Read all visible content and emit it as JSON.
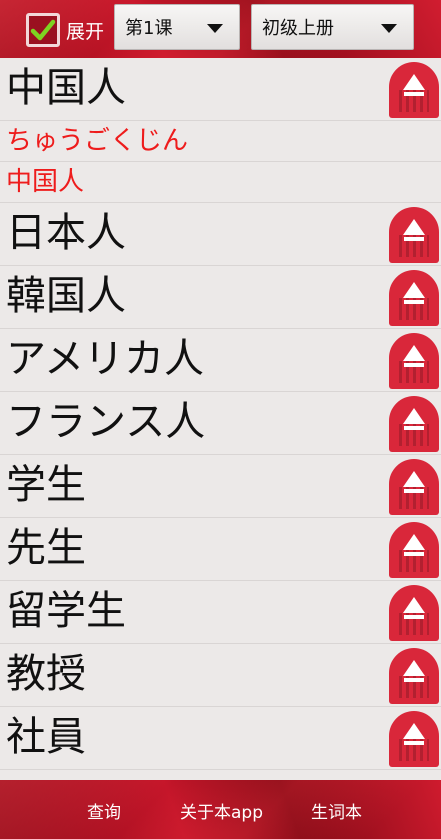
{
  "header": {
    "expand_label": "展开",
    "expand_checked": true,
    "lesson_select": "第1课",
    "book_select": "初级上册"
  },
  "words": [
    {
      "word": "中国人",
      "expanded": true,
      "reading": "ちゅうごくじん",
      "meaning": "中国人"
    },
    {
      "word": "日本人"
    },
    {
      "word": "韓国人"
    },
    {
      "word": "アメリカ人"
    },
    {
      "word": "フランス人"
    },
    {
      "word": "学生"
    },
    {
      "word": "先生"
    },
    {
      "word": "留学生"
    },
    {
      "word": "教授"
    },
    {
      "word": "社員"
    }
  ],
  "bottom_nav": {
    "search": "查询",
    "about": "关于本app",
    "vocab": "生词本"
  },
  "colors": {
    "accent": "#d9273a",
    "reading_text": "#ee1c1c",
    "list_bg": "#ece9e8"
  },
  "icons": {
    "checkbox": "check-icon",
    "play": "play-audio-icon",
    "dropdown": "chevron-down-icon"
  }
}
